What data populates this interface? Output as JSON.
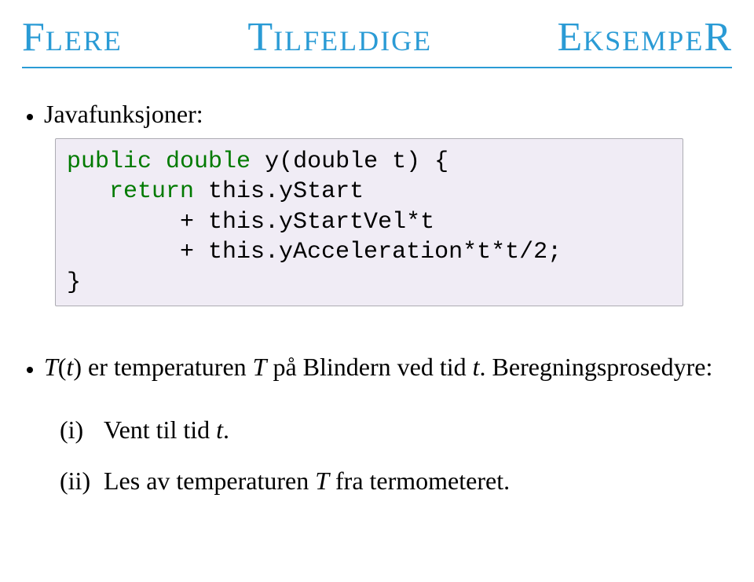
{
  "title": {
    "word1_first": "F",
    "word1_mid": "LERE",
    "word2_first": "T",
    "word2_mid": "ILFELDIGE",
    "word3_first": "E",
    "word3_mid": "KSEMPE",
    "word3_last": "R"
  },
  "bullet1": "Javafunksjoner:",
  "code": {
    "kw_public": "public",
    "kw_double": "double",
    "sig_rest": " y(double t) {",
    "indent": "   ",
    "kw_return": "return",
    "l2_rest": " this.yStart",
    "l3": "        + this.yStartVel*t",
    "l4": "        + this.yAcceleration*t*t/2;",
    "l5": "}"
  },
  "section2": {
    "prefix": " ",
    "T": "T",
    "paren_open": "(",
    "t": "t",
    "paren_close": ")",
    "text1": " er temperaturen ",
    "T2": "T",
    "text2": " på Blindern ved tid ",
    "t2": "t",
    "text3": ". Beregnings­prosedyre:"
  },
  "enum1": {
    "label": "(i)",
    "text1": "Vent til tid ",
    "t": "t",
    "text2": "."
  },
  "enum2": {
    "label": "(ii)",
    "text1": "Les av temperaturen ",
    "T": "T",
    "text2": " fra termometeret."
  }
}
